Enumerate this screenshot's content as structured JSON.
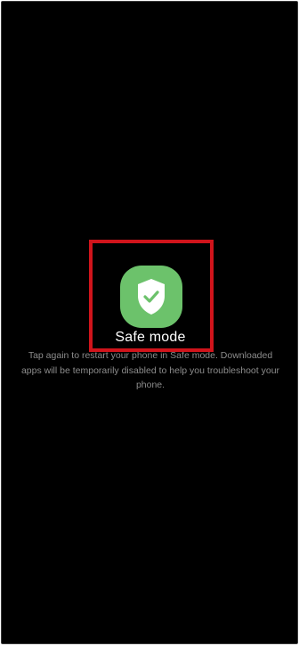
{
  "safe_mode": {
    "title": "Safe mode",
    "description": "Tap again to restart your phone in Safe mode. Downloaded apps will be temporarily disabled to help you troubleshoot your phone.",
    "icon": "shield-check-icon"
  },
  "colors": {
    "background": "#000000",
    "tile": "#6cc26b",
    "highlight": "#d0141b"
  }
}
